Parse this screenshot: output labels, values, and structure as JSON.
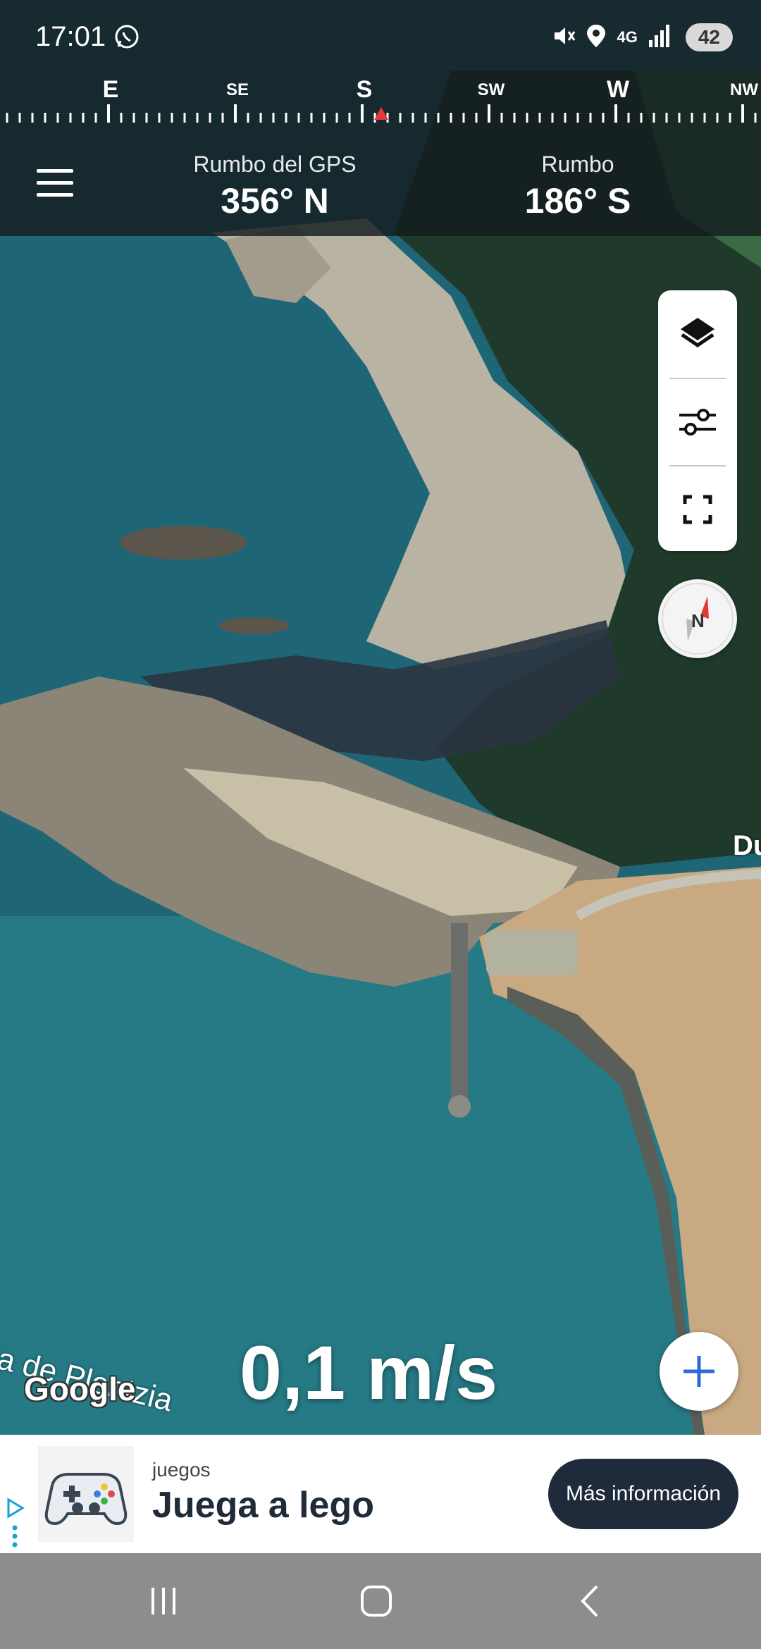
{
  "status_bar": {
    "time": "17:01",
    "network": "4G",
    "battery": "42",
    "icons": [
      "whatsapp-icon",
      "mute-icon",
      "location-icon",
      "network-4g-icon",
      "signal-icon"
    ]
  },
  "compass": {
    "labels": {
      "e": "E",
      "se": "SE",
      "s": "S",
      "sw": "SW",
      "w": "W",
      "nw": "NW"
    },
    "marker_color": "#e53935"
  },
  "header": {
    "gps_heading_label": "Rumbo del GPS",
    "gps_heading_value": "356° N",
    "heading_label": "Rumbo",
    "heading_value": "186° S"
  },
  "map": {
    "bay_label": "hia de Plentzia",
    "road_label": "Du",
    "attribution": "Google",
    "speed": "0,1 m/s"
  },
  "controls": {
    "icons": [
      "layers-icon",
      "sliders-icon",
      "fullscreen-icon",
      "compass-needle-icon",
      "plus-icon"
    ],
    "accent": "#2e6bd6"
  },
  "ad": {
    "category": "juegos",
    "title": "Juega a lego",
    "cta": "Más información",
    "image_icon": "gamepad-icon"
  },
  "nav_bar": {
    "icons": [
      "recents-icon",
      "home-icon",
      "back-icon"
    ]
  }
}
